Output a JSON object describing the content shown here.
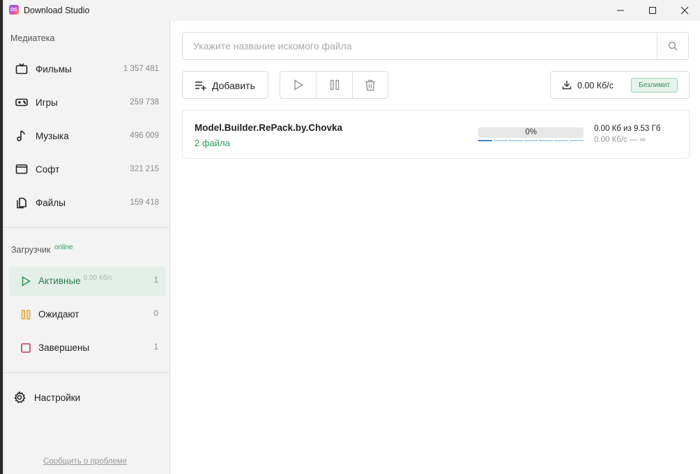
{
  "window": {
    "title": "Download Studio",
    "logo_text": "DS"
  },
  "sidebar": {
    "library_title": "Медиатека",
    "library_items": [
      {
        "label": "Фильмы",
        "count": "1 357 481",
        "icon": "tv-icon"
      },
      {
        "label": "Игры",
        "count": "259 738",
        "icon": "gamepad-icon"
      },
      {
        "label": "Музыка",
        "count": "496 009",
        "icon": "music-note-icon"
      },
      {
        "label": "Софт",
        "count": "321 215",
        "icon": "window-icon"
      },
      {
        "label": "Файлы",
        "count": "159 418",
        "icon": "files-icon"
      }
    ],
    "loader_title": "Загрузчик",
    "loader_status": "online",
    "download_items": [
      {
        "label": "Активные",
        "speed": "0.00 Кб/с",
        "count": "1",
        "icon": "play-icon",
        "color": "#2e9a5e"
      },
      {
        "label": "Ожидают",
        "count": "0",
        "icon": "pause-icon",
        "color": "#e0a325"
      },
      {
        "label": "Завершены",
        "count": "1",
        "icon": "stop-icon",
        "color": "#c03a5a"
      }
    ],
    "settings_label": "Настройки",
    "report_link": "Сообщить о проблеме"
  },
  "toolbar": {
    "search_placeholder": "Укажите название искомого файла",
    "add_label": "Добавить",
    "speed": "0.00 Кб/с",
    "limit_badge": "Безлимит"
  },
  "tasks": [
    {
      "name": "Model.Builder.RePack.by.Chovka",
      "files": "2 файла",
      "progress_text": "0%",
      "progress": 0,
      "size": "0.00 Кб из 9.53 Гб",
      "speed": "0.00 Кб/с — ∞"
    }
  ],
  "colors": {
    "accent": "#2e9a5e",
    "active_bg": "#e3efe8",
    "progress_segment": "#3a86c8"
  }
}
